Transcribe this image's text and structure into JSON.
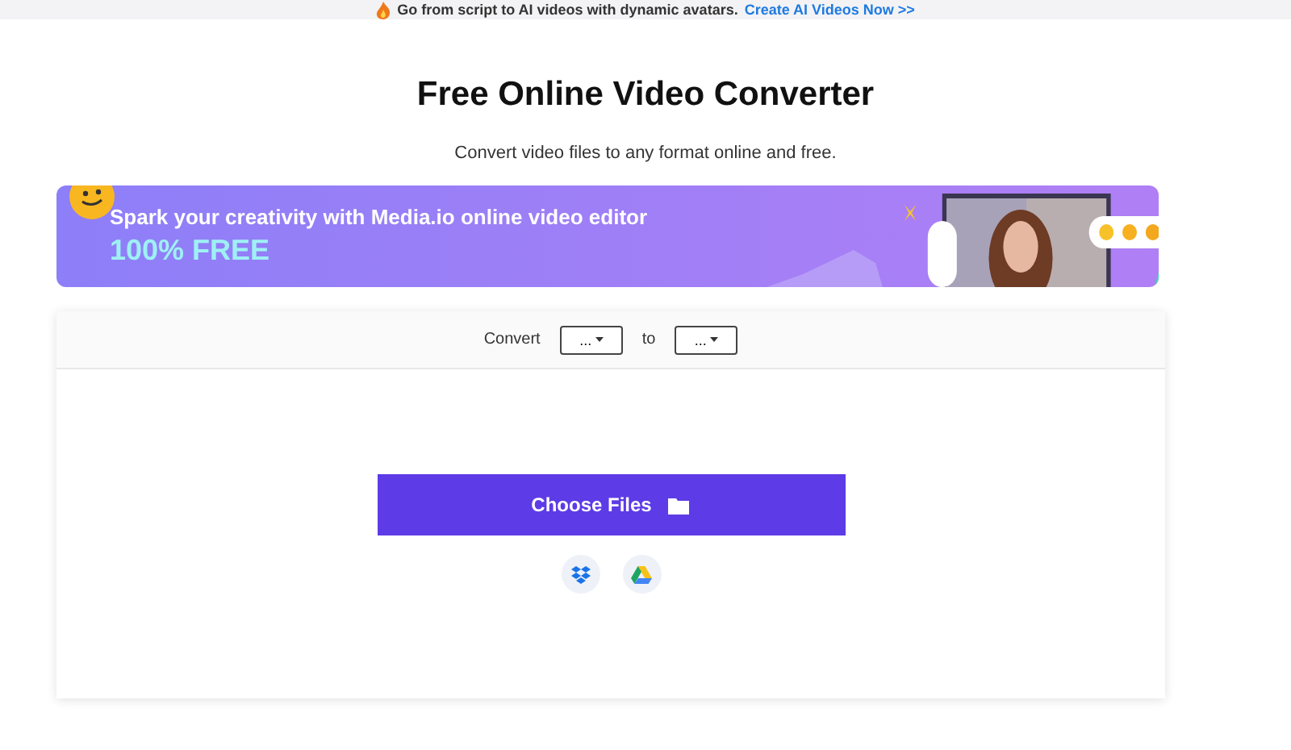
{
  "top_bar": {
    "text": "Go from script to AI videos with dynamic avatars.",
    "link": "Create AI Videos Now >>"
  },
  "title": "Free Online Video Converter",
  "subtitle": "Convert video files to any format online and free.",
  "banner": {
    "headline": "Spark your creativity with Media.io online video editor",
    "tagline": "100% FREE"
  },
  "converter": {
    "label": "Convert",
    "from": "...",
    "separator": "to",
    "to": "...",
    "button": "Choose Files"
  }
}
